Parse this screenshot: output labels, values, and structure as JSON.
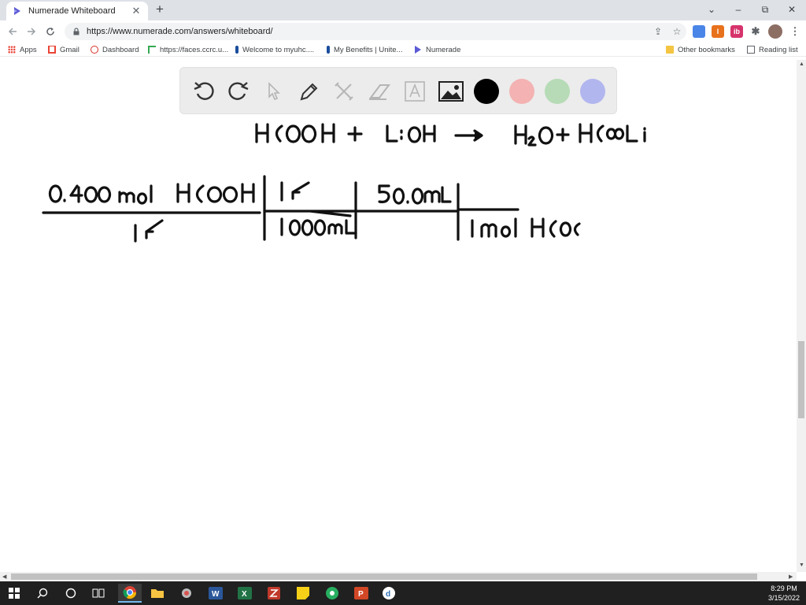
{
  "browser": {
    "tab_title": "Numerade Whiteboard",
    "tab_close": "✕",
    "new_tab": "+",
    "url": "https://www.numerade.com/answers/whiteboard/",
    "window": {
      "minimize": "–",
      "maximize": "⧉",
      "close": "✕",
      "tab_search": "⌄"
    }
  },
  "bookmarks": [
    {
      "label": "Apps",
      "icon": "apps-grid-icon"
    },
    {
      "label": "Gmail",
      "icon": "gmail-icon"
    },
    {
      "label": "Dashboard",
      "icon": "dashboard-icon"
    },
    {
      "label": "https://faces.ccrc.u...",
      "icon": "faces-icon"
    },
    {
      "label": "Welcome to myuhc....",
      "icon": "uhc-icon"
    },
    {
      "label": "My Benefits | Unite...",
      "icon": "uhc-icon"
    },
    {
      "label": "Numerade",
      "icon": "numerade-icon"
    }
  ],
  "bookmarks_right": {
    "other": "Other bookmarks",
    "reading": "Reading list"
  },
  "whiteboard": {
    "tools": [
      "undo-icon",
      "redo-icon",
      "pointer-icon",
      "pen-icon",
      "tools-icon",
      "eraser-icon",
      "text-icon",
      "image-icon"
    ],
    "colors": [
      "#000000",
      "#f4b2b2",
      "#b6dbb6",
      "#b2b6ef"
    ],
    "handwriting": {
      "equation": "HCOOH + LiOH → H2O + HCOOLi",
      "top_left": "0.400 mol HCOOH",
      "bottom_left": "1L",
      "top_mid": "1L",
      "bottom_mid": "1000mL",
      "top_right": "50.0mL",
      "bottom_right": "1mol HCOO"
    }
  },
  "taskbar": {
    "time": "8:29 PM",
    "date": "3/15/2022"
  }
}
